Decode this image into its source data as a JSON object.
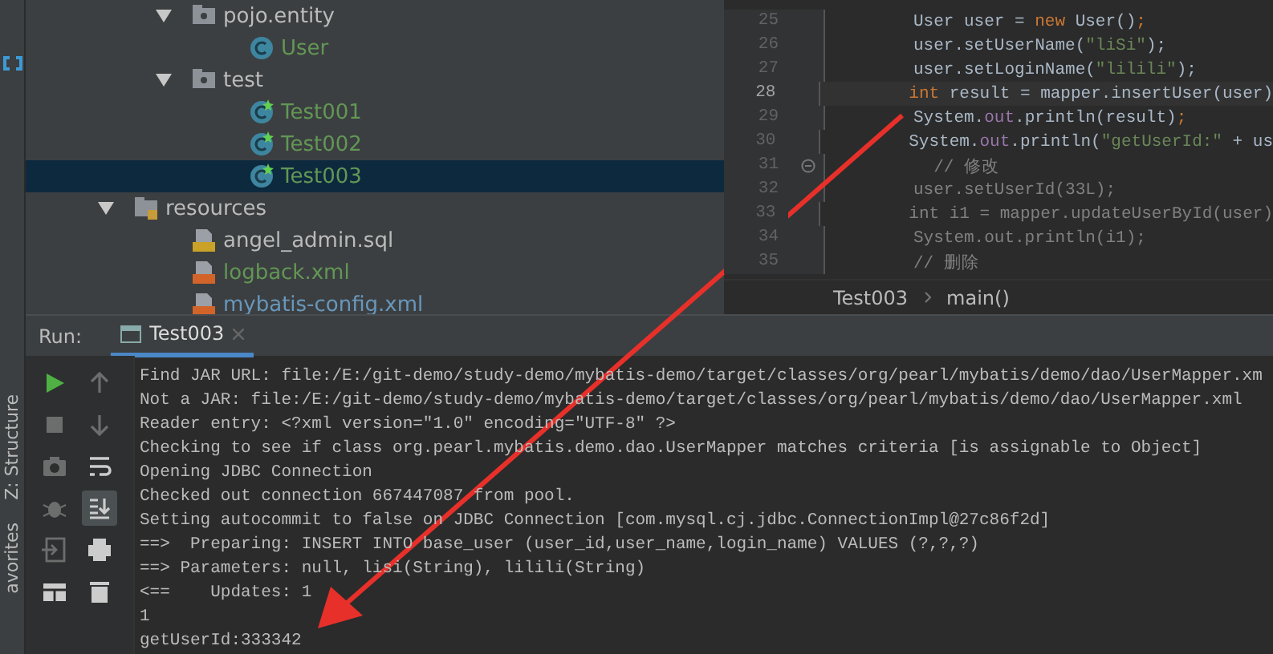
{
  "project_tree": [
    {
      "children": [
        {
          "label": "pojo.entity",
          "kind": "package",
          "color": "#bbbbbb",
          "expanded": true,
          "selected": false,
          "children": [
            {
              "label": "User",
              "kind": "class",
              "color": "#629755",
              "selected": false
            }
          ]
        },
        {
          "label": "test",
          "kind": "package",
          "color": "#bbbbbb",
          "expanded": true,
          "selected": false,
          "children": [
            {
              "label": "Test001",
              "kind": "test_class",
              "color": "#629755",
              "selected": false
            },
            {
              "label": "Test002",
              "kind": "test_class",
              "color": "#629755",
              "selected": false
            },
            {
              "label": "Test003",
              "kind": "test_class",
              "color": "#629755",
              "selected": true
            }
          ]
        }
      ]
    },
    {
      "label": "resources",
      "kind": "resources",
      "color": "#bbbbbb",
      "expanded": true,
      "selected": false,
      "children": [
        {
          "label": "angel_admin.sql",
          "kind": "sql",
          "color": "#bbbbbb",
          "selected": false
        },
        {
          "label": "logback.xml",
          "kind": "xml",
          "color": "#629755",
          "selected": false
        },
        {
          "label": "mybatis-config.xml",
          "kind": "xml",
          "color": "#6897bb",
          "selected": false
        }
      ]
    }
  ],
  "editor": {
    "lines": [
      {
        "number": "25",
        "current": false,
        "fold": false,
        "tokens": [
          {
            "text": "User user = ",
            "kind": "plain"
          },
          {
            "text": "new",
            "kind": "keyword"
          },
          {
            "text": " User()",
            "kind": "plain"
          },
          {
            "text": ";",
            "kind": "keyword"
          }
        ]
      },
      {
        "number": "26",
        "current": false,
        "fold": false,
        "tokens": [
          {
            "text": "user.setUserName(",
            "kind": "plain"
          },
          {
            "text": "\"liSi\"",
            "kind": "string"
          },
          {
            "text": ");",
            "kind": "plain"
          }
        ]
      },
      {
        "number": "27",
        "current": false,
        "fold": false,
        "tokens": [
          {
            "text": "user.setLoginName(",
            "kind": "plain"
          },
          {
            "text": "\"lilili\"",
            "kind": "string"
          },
          {
            "text": ");",
            "kind": "plain"
          }
        ]
      },
      {
        "number": "28",
        "current": true,
        "fold": false,
        "tokens": [
          {
            "text": "int",
            "kind": "keyword"
          },
          {
            "text": " result = mapper.insertUser(user)",
            "kind": "plain"
          }
        ]
      },
      {
        "number": "29",
        "current": false,
        "fold": false,
        "tokens": [
          {
            "text": "System.",
            "kind": "plain"
          },
          {
            "text": "out",
            "kind": "field"
          },
          {
            "text": ".println(result)",
            "kind": "plain"
          },
          {
            "text": ";",
            "kind": "keyword"
          }
        ]
      },
      {
        "number": "30",
        "current": false,
        "fold": false,
        "tokens": [
          {
            "text": "System.",
            "kind": "plain"
          },
          {
            "text": "out",
            "kind": "field"
          },
          {
            "text": ".println(",
            "kind": "plain"
          },
          {
            "text": "\"getUserId:\"",
            "kind": "string"
          },
          {
            "text": " + us",
            "kind": "plain"
          }
        ]
      },
      {
        "number": "31",
        "current": false,
        "fold": true,
        "tokens": [
          {
            "text": "  // 修改",
            "kind": "comment"
          }
        ]
      },
      {
        "number": "32",
        "current": false,
        "fold": false,
        "tokens": [
          {
            "text": "user.setUserId(33L);",
            "kind": "comment"
          }
        ]
      },
      {
        "number": "33",
        "current": false,
        "fold": false,
        "tokens": [
          {
            "text": "int i1 = mapper.updateUserById(user)",
            "kind": "comment"
          }
        ]
      },
      {
        "number": "34",
        "current": false,
        "fold": false,
        "tokens": [
          {
            "text": "System.out.println(i1);",
            "kind": "comment"
          }
        ]
      },
      {
        "number": "35",
        "current": false,
        "fold": false,
        "tokens": [
          {
            "text": "// 删除",
            "kind": "comment"
          }
        ]
      }
    ],
    "breadcrumb": [
      "Test003",
      "main()"
    ]
  },
  "run_panel": {
    "label": "Run:",
    "tabs": [
      {
        "label": "Test003",
        "selected": true
      }
    ],
    "toolbar": [
      {
        "kind": "run",
        "on": false,
        "disabled": false
      },
      {
        "kind": "up",
        "on": false,
        "disabled": true
      },
      {
        "kind": "stop",
        "on": false,
        "disabled": true
      },
      {
        "kind": "down",
        "on": false,
        "disabled": true
      },
      {
        "kind": "camera",
        "on": false,
        "disabled": true
      },
      {
        "kind": "wrap",
        "on": false,
        "disabled": false
      },
      {
        "kind": "bug",
        "on": false,
        "disabled": true
      },
      {
        "kind": "scroll",
        "on": true,
        "disabled": false
      },
      {
        "kind": "exit",
        "on": false,
        "disabled": true
      },
      {
        "kind": "print",
        "on": false,
        "disabled": false
      },
      {
        "kind": "layout",
        "on": false,
        "disabled": false
      },
      {
        "kind": "trash",
        "on": false,
        "disabled": false
      }
    ],
    "console": [
      "Find JAR URL: file:/E:/git-demo/study-demo/mybatis-demo/target/classes/org/pearl/mybatis/demo/dao/UserMapper.xm",
      "Not a JAR: file:/E:/git-demo/study-demo/mybatis-demo/target/classes/org/pearl/mybatis/demo/dao/UserMapper.xml",
      "Reader entry: <?xml version=\"1.0\" encoding=\"UTF-8\" ?>",
      "Checking to see if class org.pearl.mybatis.demo.dao.UserMapper matches criteria [is assignable to Object]",
      "Opening JDBC Connection",
      "Checked out connection 667447087 from pool.",
      "Setting autocommit to false on JDBC Connection [com.mysql.cj.jdbc.ConnectionImpl@27c86f2d]",
      "==>  Preparing: INSERT INTO base_user (user_id,user_name,login_name) VALUES (?,?,?)",
      "==> Parameters: null, lisi(String), lilili(String)",
      "<==    Updates: 1",
      "1",
      "getUserId:333342"
    ]
  },
  "side_strip": {
    "labels": [
      "Z: Structure",
      "avorites"
    ]
  }
}
